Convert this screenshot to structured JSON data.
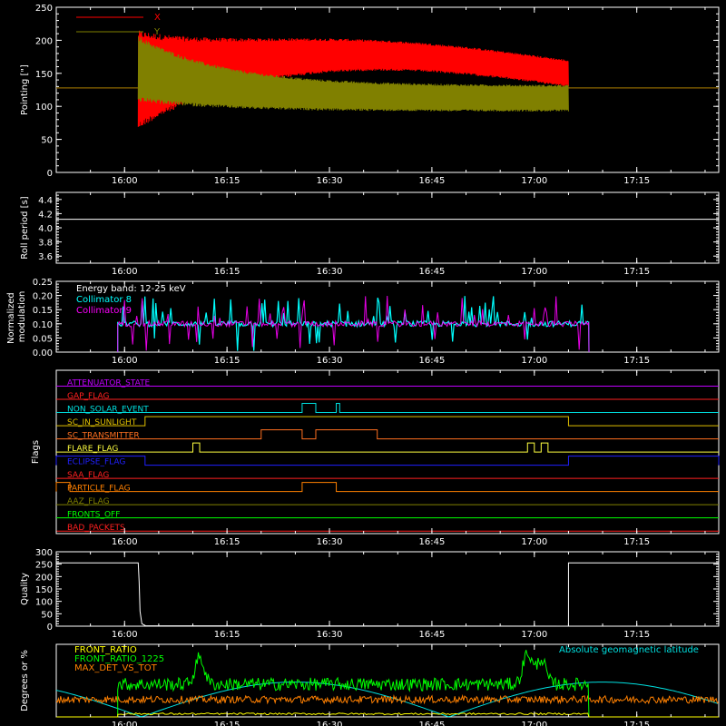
{
  "chart_data": [
    {
      "type": "line",
      "ylabel": "Pointing [\"]",
      "xticks": [
        "16:00",
        "16:15",
        "16:30",
        "16:45",
        "17:00",
        "17:15"
      ],
      "xlim": [
        "15:50",
        "17:27"
      ],
      "ylim": [
        0,
        250
      ],
      "yticks": [
        0,
        50,
        100,
        150,
        200,
        250
      ],
      "legend": "top-left",
      "series": [
        {
          "name": "X",
          "color": "#ff0000",
          "baseline": 128,
          "active": [
            "16:02",
            "17:05"
          ],
          "center_start": 140,
          "center_mid": 155,
          "center_end": 150,
          "amplitude_start": 75,
          "amplitude_end": 20
        },
        {
          "name": "Y",
          "color": "#808000",
          "baseline": 128,
          "active": [
            "16:02",
            "17:05"
          ],
          "center_start": 160,
          "center_mid": 112,
          "center_end": 105,
          "amplitude_start": 50,
          "amplitude_end": 20
        }
      ]
    },
    {
      "type": "line",
      "ylabel": "Roll period [s]",
      "xticks": [
        "16:00",
        "16:15",
        "16:30",
        "16:45",
        "17:00",
        "17:15"
      ],
      "xlim": [
        "15:50",
        "17:27"
      ],
      "ylim": [
        3.5,
        4.5
      ],
      "yticks": [
        "3.6",
        "3.8",
        "4.0",
        "4.2",
        "4.4"
      ],
      "series": [
        {
          "name": "",
          "color": "#ffffff",
          "value": 4.12
        }
      ]
    },
    {
      "type": "line",
      "ylabel": "Normalized modulation",
      "xticks": [
        "16:00",
        "16:15",
        "16:30",
        "16:45",
        "17:00",
        "17:15"
      ],
      "xlim": [
        "15:50",
        "17:27"
      ],
      "ylim": [
        0,
        0.25
      ],
      "yticks": [
        "0.00",
        "0.05",
        "0.10",
        "0.15",
        "0.20",
        "0.25"
      ],
      "annotation": "Energy band: 12-25 keV",
      "legend": "top-left",
      "series": [
        {
          "name": "Collimator 8",
          "color": "#00ffff",
          "level": 0.1,
          "active": [
            "15:59",
            "17:08"
          ]
        },
        {
          "name": "Collimator 9",
          "color": "#ff00ff",
          "level": 0.1,
          "active": [
            "15:59",
            "17:08"
          ]
        }
      ]
    },
    {
      "type": "line",
      "ylabel": "Flags",
      "xticks": [
        "16:00",
        "16:15",
        "16:30",
        "16:45",
        "17:00",
        "17:15"
      ],
      "xlim": [
        "15:50",
        "17:27"
      ],
      "flags": [
        {
          "name": "ATTENUATOR_STATE",
          "color": "#c000ff",
          "on": []
        },
        {
          "name": "GAP_FLAG",
          "color": "#ff2020",
          "on": []
        },
        {
          "name": "NON_SOLAR_EVENT",
          "color": "#00e0e0",
          "on": [
            [
              "16:26",
              "16:28"
            ],
            [
              "16:31",
              "16:31.5"
            ]
          ]
        },
        {
          "name": "SC_IN_SUNLIGHT",
          "color": "#e0c000",
          "on": [
            [
              "16:03",
              "17:05"
            ]
          ]
        },
        {
          "name": "SC_TRANSMITTER",
          "color": "#ff7020",
          "on": [
            [
              "16:20",
              "16:26"
            ],
            [
              "16:28",
              "16:37"
            ]
          ]
        },
        {
          "name": "FLARE_FLAG",
          "color": "#ffff40",
          "on": [
            [
              "16:10",
              "16:11"
            ],
            [
              "16:59",
              "17:00"
            ],
            [
              "17:01",
              "17:02"
            ]
          ]
        },
        {
          "name": "ECLIPSE_FLAG",
          "color": "#2020ff",
          "on": [
            [
              "15:50",
              "16:03"
            ],
            [
              "17:05",
              "17:27"
            ]
          ]
        },
        {
          "name": "SAA_FLAG",
          "color": "#ff2020",
          "on": []
        },
        {
          "name": "PARTICLE_FLAG",
          "color": "#ff8000",
          "on": [
            [
              "15:50",
              "15:52"
            ],
            [
              "16:26",
              "16:31"
            ]
          ]
        },
        {
          "name": "AAZ_FLAG",
          "color": "#808000",
          "on": []
        },
        {
          "name": "FRONTS_OFF",
          "color": "#00ff00",
          "on": []
        },
        {
          "name": "BAD_PACKETS",
          "color": "#ff2020",
          "on": []
        }
      ]
    },
    {
      "type": "line",
      "ylabel": "Quality",
      "xticks": [
        "16:00",
        "16:15",
        "16:30",
        "16:45",
        "17:00",
        "17:15"
      ],
      "xlim": [
        "15:50",
        "17:27"
      ],
      "ylim": [
        0,
        300
      ],
      "yticks": [
        0,
        50,
        100,
        150,
        200,
        250,
        300
      ],
      "series": [
        {
          "name": "",
          "color": "#ffffff",
          "high": 255,
          "low": 0,
          "drop": "16:02",
          "rise": "17:05"
        }
      ]
    },
    {
      "type": "line",
      "ylabel": "Degrees or %",
      "xticks": [
        "16:00",
        "16:15",
        "16:30",
        "16:45",
        "17:00",
        "17:15"
      ],
      "xlim": [
        "15:50",
        "17:27"
      ],
      "ylim": [
        0,
        100
      ],
      "legend": "top-left",
      "annotation": "Absolute geomagnetic latitude",
      "annotation_color": "#00e0e0",
      "series": [
        {
          "name": "FRONT_RATIO",
          "color": "#ffff00",
          "level": 3,
          "active": [
            "15:59",
            "17:08"
          ]
        },
        {
          "name": "FRONT_RATIO_1225",
          "color": "#00ff00",
          "level": 45,
          "active": [
            "15:59",
            "17:08"
          ],
          "peaks": [
            [
              "16:11",
              82
            ],
            [
              "16:59",
              88
            ],
            [
              "17:01",
              80
            ]
          ]
        },
        {
          "name": "MAX_DET_VS_TOT",
          "color": "#ff8000",
          "level": 24
        },
        {
          "name": "Absolute geomagnetic latitude",
          "color": "#00e0e0",
          "max": 48,
          "min": 0
        }
      ]
    }
  ]
}
